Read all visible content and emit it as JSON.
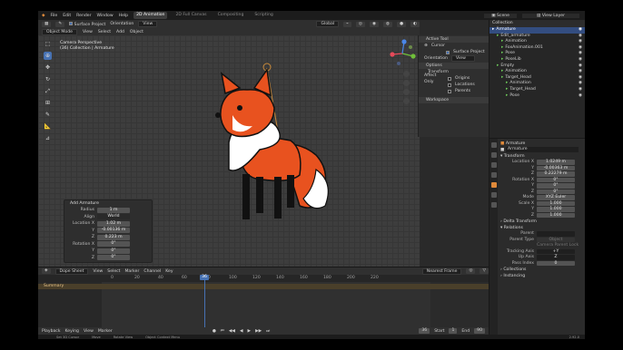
{
  "top_menu": {
    "items": [
      "File",
      "Edit",
      "Render",
      "Window",
      "Help"
    ],
    "workspaces": [
      "2D Animation",
      "2D Full Canvas",
      "Compositing",
      "Scripting"
    ],
    "active_workspace": "2D Animation",
    "scene": "Scene",
    "view_layer": "View Layer"
  },
  "viewport_header": {
    "mode": "Object Mode",
    "menus": [
      "View",
      "Select",
      "Add",
      "Object"
    ],
    "surface_project": "Surface Project",
    "orientation_label": "Orientation",
    "orientation_value": "View",
    "global": "Global"
  },
  "overlay": {
    "line1": "Camera Perspective",
    "line2": "(36) Collection | Armature"
  },
  "npanel": {
    "active_tool": "Active Tool",
    "tool_name": "Cursor",
    "surface_project": "Surface Project",
    "orientation_label": "Orientation",
    "orientation_value": "View",
    "options": "Options",
    "transform": "Transform",
    "affect_only": "Affect Only",
    "origins": "Origins",
    "locations": "Locations",
    "parents": "Parents",
    "workspace": "Workspace",
    "tabs": [
      "Tool",
      "View"
    ]
  },
  "adjust_panel": {
    "title": "Add Armature",
    "fields": [
      {
        "label": "Radius",
        "value": "1 m"
      },
      {
        "label": "Align",
        "value": "World"
      },
      {
        "label": "Location X",
        "value": "1.02 m"
      },
      {
        "label": "Y",
        "value": "-0.00136 m"
      },
      {
        "label": "Z",
        "value": "0.223 m"
      },
      {
        "label": "Rotation X",
        "value": "0°"
      },
      {
        "label": "Y",
        "value": "0°"
      },
      {
        "label": "Z",
        "value": "0°"
      }
    ]
  },
  "outliner": {
    "title": "Collection",
    "items": [
      {
        "label": "Armature",
        "selected": true,
        "indent": 0
      },
      {
        "label": "Edit_armature",
        "selected": false,
        "indent": 1
      },
      {
        "label": "Animation",
        "selected": false,
        "indent": 2
      },
      {
        "label": "FoxAnimation.001",
        "selected": false,
        "indent": 2
      },
      {
        "label": "Pose",
        "selected": false,
        "indent": 2
      },
      {
        "label": "PoseLib",
        "selected": false,
        "indent": 2
      },
      {
        "label": "Empty",
        "selected": false,
        "indent": 1
      },
      {
        "label": "Animation",
        "selected": false,
        "indent": 2
      },
      {
        "label": "Target_Head",
        "selected": false,
        "indent": 2
      },
      {
        "label": "Animation",
        "selected": false,
        "indent": 3
      },
      {
        "label": "Target_Head",
        "selected": false,
        "indent": 3
      },
      {
        "label": "Pose",
        "selected": false,
        "indent": 3
      }
    ]
  },
  "properties": {
    "object": "Armature",
    "name": "Armature",
    "transform": "Transform",
    "fields": [
      {
        "label": "Location X",
        "value": "1.0249 m"
      },
      {
        "label": "Y",
        "value": "-0.00363 m"
      },
      {
        "label": "Z",
        "value": "0.22279 m"
      },
      {
        "label": "Rotation X",
        "value": "0°"
      },
      {
        "label": "Y",
        "value": "0°"
      },
      {
        "label": "Z",
        "value": "0°"
      },
      {
        "label": "Mode",
        "value": "XYZ Euler"
      },
      {
        "label": "Scale X",
        "value": "1.000"
      },
      {
        "label": "Y",
        "value": "1.000"
      },
      {
        "label": "Z",
        "value": "1.000"
      }
    ],
    "delta": "Delta Transform",
    "relations": "Relations",
    "parent_label": "Parent",
    "parent_type_label": "Parent Type",
    "parent_type_value": "Object",
    "camera_parent": "Camera Parent Lock",
    "tracking_label": "Tracking Axis",
    "tracking_value": "+Y",
    "up_label": "Up Axis",
    "up_value": "Z",
    "pass_label": "Pass Index",
    "pass_value": "0",
    "collections": "Collections",
    "instancing": "Instancing"
  },
  "dopesheet": {
    "mode": "Dope Sheet",
    "menus": [
      "View",
      "Select",
      "Marker",
      "Channel",
      "Key"
    ],
    "snapping": "Nearest Frame",
    "summary": "Summary",
    "ticks": [
      "0",
      "20",
      "40",
      "60",
      "80",
      "100",
      "120",
      "140",
      "160",
      "180",
      "200",
      "220"
    ],
    "current_frame": "36"
  },
  "playback": {
    "items": [
      "Playback",
      "Keying",
      "View",
      "Marker"
    ],
    "frame": "36",
    "start_label": "Start",
    "start": "1",
    "end_label": "End",
    "end": "90"
  },
  "status": {
    "items": [
      "Set 3D Cursor",
      "Move",
      "Rotate View",
      "Object Context Menu"
    ],
    "version": "2.92.0"
  }
}
